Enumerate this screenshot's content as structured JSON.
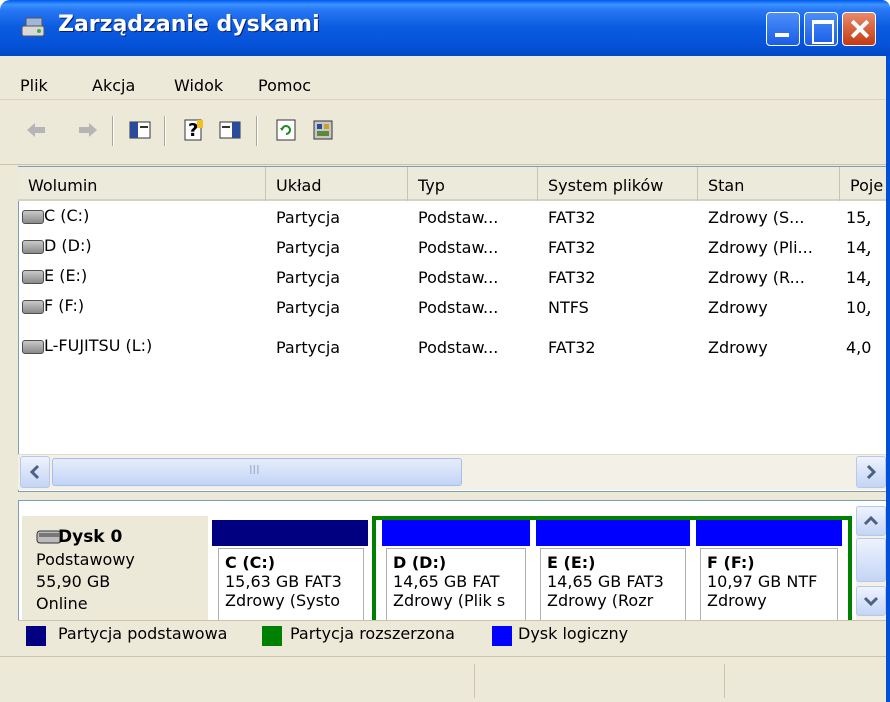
{
  "window": {
    "title": "Zarządzanie dyskami"
  },
  "menu": [
    "Plik",
    "Akcja",
    "Widok",
    "Pomoc"
  ],
  "toolbar": {
    "icons": [
      "back-arrow-icon",
      "forward-arrow-icon",
      "show-hide-tree-icon",
      "help-icon",
      "show-hide-action-pane-icon",
      "refresh-icon",
      "properties-icon"
    ]
  },
  "volume_list": {
    "columns": [
      "Wolumin",
      "Układ",
      "Typ",
      "System plików",
      "Stan",
      "Poje"
    ],
    "rows": [
      {
        "volume": "C (C:)",
        "layout": "Partycja",
        "type": "Podstaw...",
        "fs": "FAT32",
        "status": "Zdrowy (S...",
        "capacity": "15,̧"
      },
      {
        "volume": "D (D:)",
        "layout": "Partycja",
        "type": "Podstaw...",
        "fs": "FAT32",
        "status": "Zdrowy (Pli...",
        "capacity": "14,̧"
      },
      {
        "volume": "E (E:)",
        "layout": "Partycja",
        "type": "Podstaw...",
        "fs": "FAT32",
        "status": "Zdrowy (R...",
        "capacity": "14,̧"
      },
      {
        "volume": "F (F:)",
        "layout": "Partycja",
        "type": "Podstaw...",
        "fs": "NTFS",
        "status": "Zdrowy",
        "capacity": "10,̧"
      },
      {
        "volume": "L-FUJITSU (L:)",
        "layout": "Partycja",
        "type": "Podstaw...",
        "fs": "FAT32",
        "status": "Zdrowy",
        "capacity": "4,0"
      }
    ]
  },
  "hscroll": {
    "thumb_grip": "III"
  },
  "disk": {
    "name": "Dysk 0",
    "type": "Podstawowy",
    "size": "55,90 GB",
    "state": "Online",
    "segments": [
      {
        "name": "C  (C:)",
        "line1": "15,63 GB FAT3",
        "line2": "Zdrowy (Systo"
      },
      {
        "name": "D  (D:)",
        "line1": "14,65 GB FAT",
        "line2": "Zdrowy (Plik s"
      },
      {
        "name": "E  (E:)",
        "line1": "14,65 GB FAT3",
        "line2": "Zdrowy (Rozr"
      },
      {
        "name": "F  (F:)",
        "line1": "10,97 GB NTF",
        "line2": "Zdrowy"
      }
    ]
  },
  "legend": [
    {
      "label": "Partycja podstawowa",
      "color": "#000080"
    },
    {
      "label": "Partycja rozszerzona",
      "color": "#008000"
    },
    {
      "label": "Dysk logiczny",
      "color": "#0000ff"
    }
  ],
  "colors": {
    "primary_partition": "#000080",
    "extended_partition": "#008000",
    "logical_drive": "#0000ff"
  }
}
